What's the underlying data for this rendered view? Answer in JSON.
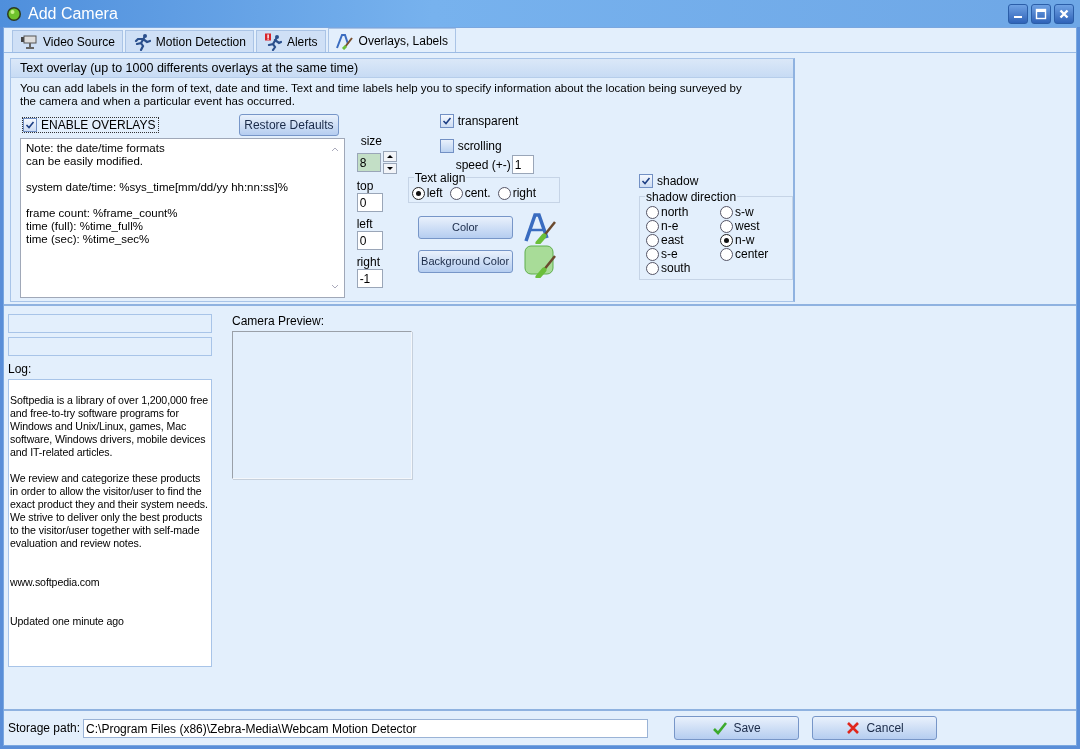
{
  "window": {
    "title": "Add Camera"
  },
  "tabs": [
    {
      "label": "Video Source",
      "selected": false,
      "kind": "camera"
    },
    {
      "label": "Motion Detection",
      "selected": false,
      "kind": "runner"
    },
    {
      "label": "Alerts",
      "selected": false,
      "kind": "alert"
    },
    {
      "label": "Overlays, Labels",
      "selected": true,
      "kind": "brush"
    }
  ],
  "overlay": {
    "title": "Text overlay (up to 1000 differents overlays at the same time)",
    "description": "You can add labels in the form of text, date and time. Text and time labels help you to specify information about the location being surveyed by the camera and when a particular event has occurred.",
    "enable_overlays": {
      "label": "ENABLE OVERLAYS",
      "checked": true
    },
    "restore_button": "Restore Defaults",
    "note_text": "Note: the date/time formats\ncan be easily modified.\n\nsystem date/time: %sys_time[mm/dd/yy hh:nn:ss]%\n\nframe count: %frame_count%\ntime (full): %time_full%\ntime (sec): %time_sec%",
    "size": {
      "label": "size",
      "value": "8"
    },
    "position_fields": [
      {
        "label": "top",
        "value": "0"
      },
      {
        "label": "left",
        "value": "0"
      },
      {
        "label": "right",
        "value": "-1"
      }
    ],
    "transparent": {
      "label": "transparent",
      "checked": true
    },
    "scrolling": {
      "label": "scrolling",
      "checked": false
    },
    "speed": {
      "label": "speed (+-)",
      "value": "1"
    },
    "text_align": {
      "label": "Text align",
      "options": [
        {
          "label": "left",
          "selected": true
        },
        {
          "label": "cent.",
          "selected": false
        },
        {
          "label": "right",
          "selected": false
        }
      ]
    },
    "color_button": "Color",
    "background_color_button": "Background Color",
    "shadow": {
      "label": "shadow",
      "checked": true
    },
    "shadow_direction": {
      "label": "shadow direction",
      "options": [
        {
          "label": "north",
          "selected": false
        },
        {
          "label": "n-e",
          "selected": false
        },
        {
          "label": "east",
          "selected": false
        },
        {
          "label": "s-e",
          "selected": false
        },
        {
          "label": "south",
          "selected": false
        },
        {
          "label": "s-w",
          "selected": false
        },
        {
          "label": "west",
          "selected": false
        },
        {
          "label": "n-w",
          "selected": true
        },
        {
          "label": "center",
          "selected": false
        }
      ]
    }
  },
  "log": {
    "label": "Log:",
    "paragraphs": [
      "Softpedia is a library of over 1,200,000 free and free-to-try software programs for Windows and Unix/Linux, games, Mac software, Windows drivers, mobile devices and IT-related articles.",
      "We review and categorize these products in order to allow the visitor/user to find the exact product they and their system needs. We strive to deliver only the best products to the visitor/user together with self-made evaluation and review notes.",
      "www.softpedia.com",
      "Updated one minute ago"
    ]
  },
  "camera_preview": {
    "label": "Camera Preview:"
  },
  "storage_path": {
    "label": "Storage path:",
    "value": "C:\\Program Files (x86)\\Zebra-Media\\Webcam Motion Detector"
  },
  "buttons": [
    {
      "label": "Save",
      "kind": "save"
    },
    {
      "label": "Cancel",
      "kind": "cancel"
    }
  ]
}
